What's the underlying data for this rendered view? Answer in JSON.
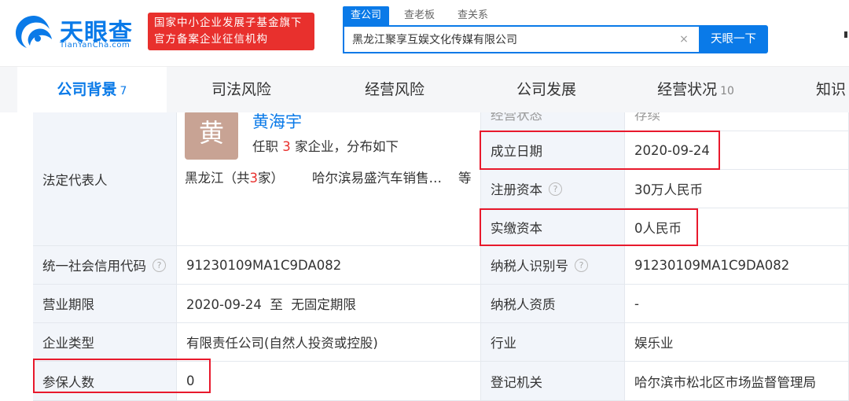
{
  "header": {
    "logo_text": "天眼查",
    "logo_sub": "TianYanCha.com",
    "badge_line1": "国家中小企业发展子基金旗下",
    "badge_line2": "官方备案企业征信机构",
    "search_tabs": [
      "查公司",
      "查老板",
      "查关系"
    ],
    "search_value": "黑龙江聚享互娱文化传媒有限公司",
    "search_button": "天眼一下",
    "clear_symbol": "×"
  },
  "nav": {
    "tabs": [
      {
        "label": "公司背景",
        "count": "7"
      },
      {
        "label": "司法风险",
        "count": ""
      },
      {
        "label": "经营风险",
        "count": ""
      },
      {
        "label": "公司发展",
        "count": ""
      },
      {
        "label": "经营状况",
        "count": "10"
      },
      {
        "label": "知识",
        "count": ""
      }
    ]
  },
  "legal": {
    "label": "法定代表人",
    "avatar_char": "黄",
    "name": "黄海宇",
    "desc_pre": "任职 ",
    "desc_count": "3",
    "desc_post": " 家企业，分布如下",
    "region_pre": "黑龙江（共",
    "region_count": "3",
    "region_post": "家）",
    "company": "哈尔滨易盛汽车销售…",
    "etc": "等"
  },
  "right_top": {
    "status_label": "经营状态",
    "status_value": "存续",
    "founded_label": "成立日期",
    "founded_value": "2020-09-24",
    "capital_label": "注册资本",
    "capital_value": "30万人民币",
    "paid_label": "实缴资本",
    "paid_value": "0人民币"
  },
  "rows": {
    "credit_code_label": "统一社会信用代码",
    "credit_code_value": "91230109MA1C9DA082",
    "taxpayer_id_label": "纳税人识别号",
    "taxpayer_id_value": "91230109MA1C9DA082",
    "term_label": "营业期限",
    "term_value": "2020-09-24  至  无固定期限",
    "taxpayer_qual_label": "纳税人资质",
    "taxpayer_qual_value": "-",
    "type_label": "企业类型",
    "type_value": "有限责任公司(自然人投资或控股)",
    "industry_label": "行业",
    "industry_value": "娱乐业",
    "insured_label": "参保人数",
    "insured_value": "0",
    "registry_label": "登记机关",
    "registry_value": "哈尔滨市松北区市场监督管理局"
  },
  "colors": {
    "brand": "#0a7ae8",
    "badge": "#e8302d",
    "highlight": "#e8192c",
    "label_bg": "#f2f5fa"
  }
}
